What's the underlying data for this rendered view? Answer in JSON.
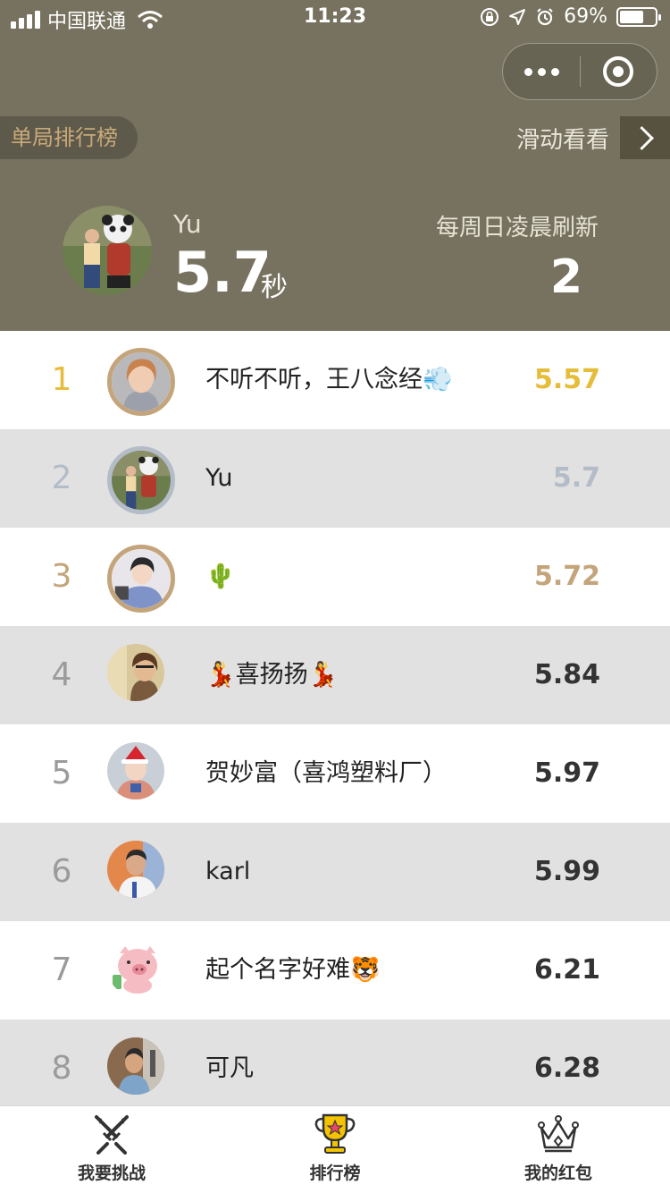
{
  "status_bar": {
    "carrier": "中国联通",
    "time": "11:23",
    "battery": "69%",
    "battery_level": 0.69
  },
  "header": {
    "tab_label": "单局排行榜",
    "swipe_label": "滑动看看",
    "me": {
      "name": "Yu",
      "score": "5.7",
      "unit": "秒"
    },
    "refresh_label": "每周日凌晨刷新",
    "rank": "2"
  },
  "colors": {
    "header_bg": "#77725f",
    "gold": "#e6bd3a",
    "silver": "#b3bcc7",
    "bronze": "#c4a57b"
  },
  "leaderboard": [
    {
      "rank": "1",
      "name": "不听不听，王八念经💨",
      "score": "5.57",
      "medal": "gold",
      "avatar": "girl-portrait"
    },
    {
      "rank": "2",
      "name": "Yu",
      "score": "5.7",
      "medal": "silver",
      "avatar": "panda-photo"
    },
    {
      "rank": "3",
      "name": "🌵",
      "score": "5.72",
      "medal": "bronze",
      "avatar": "girl-blue-sweater"
    },
    {
      "rank": "4",
      "name": "💃喜扬扬💃",
      "score": "5.84",
      "medal": "",
      "avatar": "woman-glasses"
    },
    {
      "rank": "5",
      "name": "贺妙富（喜鸿塑料厂）",
      "score": "5.97",
      "medal": "",
      "avatar": "child-santa-hat"
    },
    {
      "rank": "6",
      "name": "karl",
      "score": "5.99",
      "medal": "",
      "avatar": "man-sports"
    },
    {
      "rank": "7",
      "name": "起个名字好难🐯",
      "score": "6.21",
      "medal": "",
      "avatar": "pink-pig-cartoon"
    },
    {
      "rank": "8",
      "name": "可凡",
      "score": "6.28",
      "medal": "",
      "avatar": "man-street"
    }
  ],
  "tabbar": [
    {
      "label": "我要挑战",
      "icon": "crossed-swords-icon"
    },
    {
      "label": "排行榜",
      "icon": "trophy-icon"
    },
    {
      "label": "我的红包",
      "icon": "crown-icon"
    }
  ]
}
